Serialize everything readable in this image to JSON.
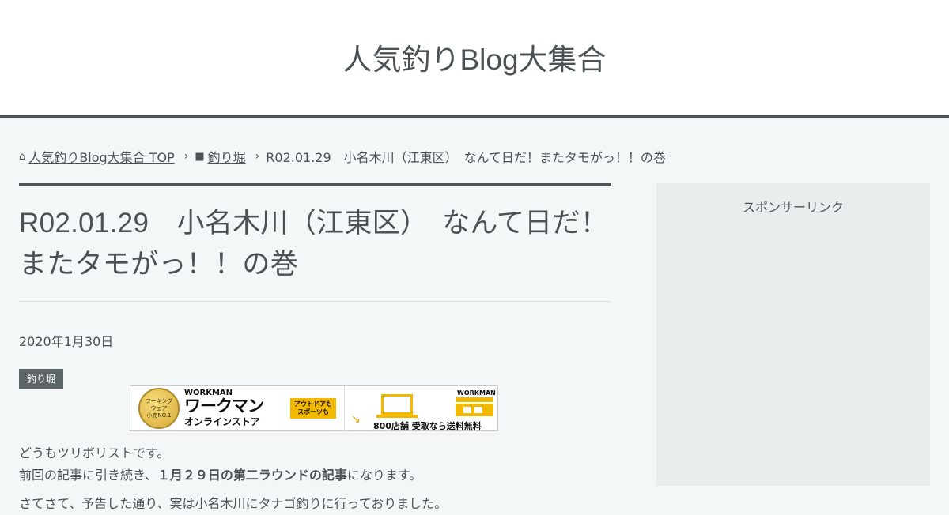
{
  "site": {
    "title": "人気釣りBlog大集合"
  },
  "breadcrumb": {
    "home_label": "人気釣りBlog大集合 TOP",
    "home_icon": "home-icon",
    "category_label": "釣り堀",
    "category_icon": "folder-icon",
    "current": "R02.01.29　小名木川（江東区）　なんて日だ！またタモがっ！！の巻"
  },
  "post": {
    "title_line1": "R02.01.29　小名木川（江東区）　なんて日だ！",
    "title_line2": "またタモがっ！！の巻",
    "date": "2020年1月30日",
    "category_badge": "釣り堀",
    "banner": {
      "medal_text": "ワーキング\nウェア\n小売NO.1",
      "brand_small": "WORKMAN",
      "brand_big": "ワークマン",
      "store_label": "オンラインストア",
      "tag_text": "アウトドアも\nスポーツも",
      "right_brand": "WORKMAN",
      "right_caption": "800店舗 受取なら送料無料"
    },
    "body": {
      "line1": "どうもツリボリストです。",
      "line2_pre": "前回の記事に引き続き、",
      "line2_bold": "１月２９日の第二ラウンドの記事",
      "line2_post": "になります。",
      "line3": "さてさて、予告した通り、実は小名木川にタナゴ釣りに行っておりました。"
    }
  },
  "sidebar": {
    "sponsor_label": "スポンサーリンク"
  },
  "colors": {
    "accent": "#4b5456",
    "background": "#f4f7f8",
    "sidebar_bg": "#e9eded"
  }
}
